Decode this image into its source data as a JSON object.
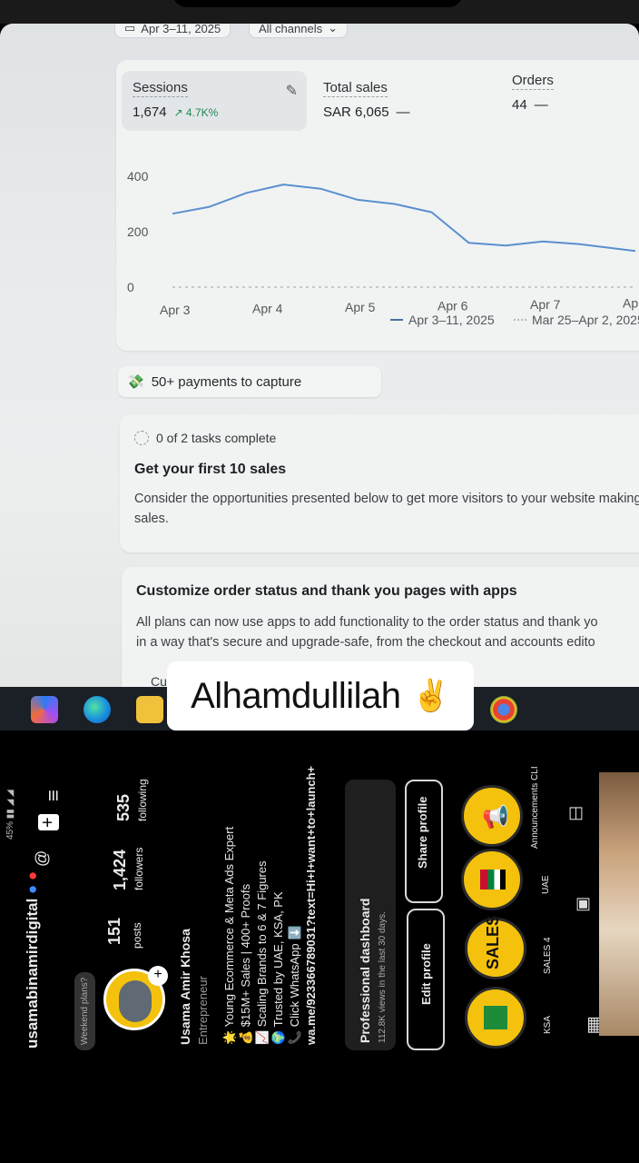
{
  "dashboard": {
    "date_filter": "Apr 3–11, 2025",
    "channel_filter": "All channels",
    "metrics": [
      {
        "title": "Sessions",
        "value": "1,674",
        "delta": "↗ 4.7K%"
      },
      {
        "title": "Total sales",
        "value": "SAR 6,065",
        "delta": "—"
      },
      {
        "title": "Orders",
        "value": "44",
        "delta": "—"
      }
    ],
    "legend_current": "Apr 3–11, 2025",
    "legend_previous": "Mar 25–Apr 2, 2025",
    "payments_pill": "50+ payments to capture",
    "tasks_status": "0 of 2 tasks complete",
    "tasks_title": "Get your first 10 sales",
    "tasks_text": "Consider the opportunities presented below to get more visitors to your website making sales.",
    "custom_title": "Customize order status and thank you pages with apps",
    "custom_text_1": "All plans can now use apps to add functionality to the order status and thank yo",
    "custom_text_2": "in a way that's secure and upgrade-safe, from the checkout and accounts edito",
    "custom_cut": "Cu"
  },
  "chart_data": {
    "type": "line",
    "categories": [
      "Apr 3",
      "Apr 4",
      "Apr 5",
      "Apr 6",
      "Apr 7",
      "Ap"
    ],
    "series": [
      {
        "name": "Apr 3–11, 2025",
        "x": [
          0,
          0.4,
          0.8,
          1.2,
          1.6,
          2.0,
          2.4,
          2.8,
          3.2,
          3.6,
          4.0,
          4.4,
          5.0
        ],
        "values": [
          265,
          290,
          340,
          370,
          355,
          315,
          300,
          270,
          160,
          150,
          165,
          155,
          130
        ],
        "color": "#5b8fcf"
      },
      {
        "name": "Mar 25–Apr 2, 2025",
        "x": [
          0,
          5
        ],
        "values": [
          0,
          0
        ],
        "color": "#b7bcc2"
      }
    ],
    "yticks": [
      "400",
      "200",
      "0"
    ],
    "ylim": [
      0,
      400
    ]
  },
  "caption": {
    "text": "Alhamdullilah",
    "emoji": "✌️"
  },
  "instagram": {
    "username": "usamabinamirdigital",
    "posts_count": "151",
    "posts_label": "posts",
    "followers_count": "1,424",
    "followers_label": "followers",
    "following_count": "535",
    "following_label": "following",
    "note": "Weekend plans?",
    "name": "Usama Amir Khosa",
    "category": "Entrepreneur",
    "bio": [
      "🌟 Young Ecommerce & Meta Ads Expert",
      "💰 $15M+ Sales | 400+ Proofs",
      "📈 Scaling Brands to 6 & 7 Figures",
      "🌍 Trusted by UAE, KSA, PK",
      "📞 Click WhatsApp ⬇️"
    ],
    "link": "wa.me/923366789031?text=Hi+I+want+to+launch+",
    "dashboard_title": "Professional dashboard",
    "dashboard_sub": "112.8K views in the last 30 days.",
    "edit_profile": "Edit profile",
    "share_profile": "Share profile",
    "highlights": [
      "KSA",
      "SALES 4",
      "UAE",
      "Announcements CLI"
    ],
    "status": "45%",
    "sales_badge": "SALES"
  }
}
